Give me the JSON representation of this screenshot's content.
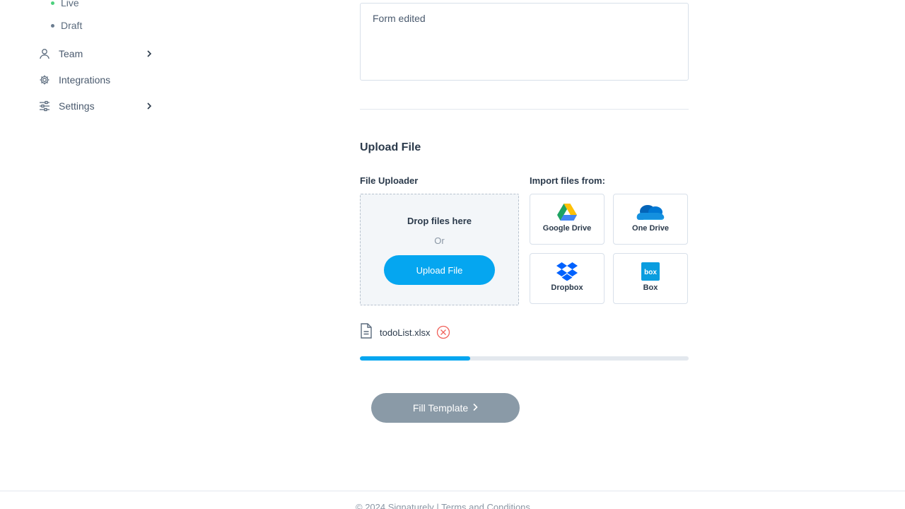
{
  "sidebar": {
    "sub_items": [
      {
        "label": "Live",
        "dot_color": "#4cd07d"
      },
      {
        "label": "Draft",
        "dot_color": "#6b7d90"
      }
    ],
    "items": [
      {
        "label": "Team",
        "icon": "user-icon",
        "has_chevron": true
      },
      {
        "label": "Integrations",
        "icon": "gear-icon",
        "has_chevron": false
      },
      {
        "label": "Settings",
        "icon": "sliders-icon",
        "has_chevron": true
      }
    ]
  },
  "note": {
    "value": "Form edited"
  },
  "upload": {
    "section_title": "Upload File",
    "uploader_label": "File Uploader",
    "import_label": "Import files from:",
    "drop_text": "Drop files here",
    "or_text": "Or",
    "button_label": "Upload File",
    "providers": [
      {
        "label": "Google Drive",
        "icon": "google-drive-icon"
      },
      {
        "label": "One Drive",
        "icon": "onedrive-icon"
      },
      {
        "label": "Dropbox",
        "icon": "dropbox-icon"
      },
      {
        "label": "Box",
        "icon": "box-icon"
      }
    ]
  },
  "file": {
    "name": "todoList.xlsx",
    "progress": 0.335
  },
  "actions": {
    "fill_template_label": "Fill Template"
  },
  "footer": {
    "copyright": "© 2024 Signaturely",
    "separator": "|",
    "terms_label": "Terms and Conditions"
  },
  "colors": {
    "accent": "#05a6f0",
    "disabled_button": "#8a9aa7",
    "remove_icon": "#f0625b"
  }
}
